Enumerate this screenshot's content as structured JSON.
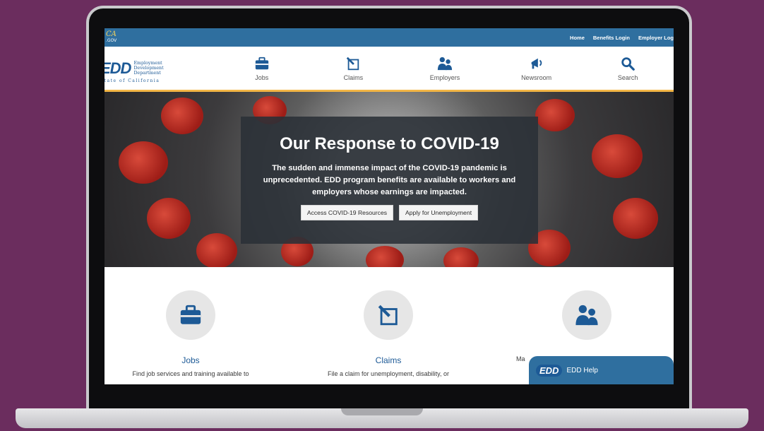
{
  "topbar": {
    "ca_logo": "CA",
    "ca_logo_sub": ".GOV",
    "links": [
      "Home",
      "Benefits Login",
      "Employer Log"
    ]
  },
  "brand": {
    "letters": "EDD",
    "line1": "Employment",
    "line2": "Development",
    "line3": "Department",
    "state": "State of California"
  },
  "nav": {
    "items": [
      {
        "label": "Jobs",
        "icon": "briefcase-icon"
      },
      {
        "label": "Claims",
        "icon": "claim-form-icon"
      },
      {
        "label": "Employers",
        "icon": "people-icon"
      },
      {
        "label": "Newsroom",
        "icon": "megaphone-icon"
      },
      {
        "label": "Search",
        "icon": "search-icon"
      }
    ]
  },
  "hero": {
    "title": "Our Response to COVID-19",
    "text": "The sudden and immense impact of the COVID-19 pandemic is unprecedented. EDD program benefits are available to workers and employers whose earnings are impacted.",
    "button1": "Access COVID-19 Resources",
    "button2": "Apply for Unemployment"
  },
  "features": [
    {
      "title": "Jobs",
      "desc": "Find job services and training available to",
      "icon": "briefcase-icon"
    },
    {
      "title": "Claims",
      "desc": "File a claim for unemployment, disability, or",
      "icon": "claim-form-icon"
    },
    {
      "title": "",
      "desc": "Ma",
      "icon": "people-icon"
    }
  ],
  "help": {
    "logo": "EDD",
    "label": "EDD Help"
  },
  "colors": {
    "background": "#6b2d5e",
    "brand_blue": "#1d5a96",
    "topbar_blue": "#2f6f9f",
    "accent_gold": "#f2b545"
  }
}
